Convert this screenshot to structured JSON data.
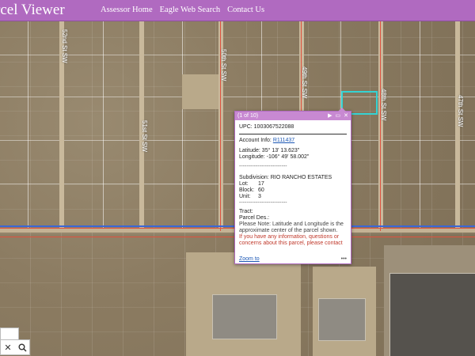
{
  "header": {
    "title": "rcel Viewer",
    "nav": [
      "Assessor Home",
      "Eagle Web Search",
      "Contact Us"
    ]
  },
  "map": {
    "streets": [
      "52nd St SW",
      "51st St SW",
      "50th St SW",
      "49th St SW",
      "48th St SW",
      "47th St SW"
    ]
  },
  "search": {
    "clear_icon": "✕",
    "search_icon": "search-icon"
  },
  "popup": {
    "count": "(1 of 10)",
    "upc": "UPC: 1003067522088",
    "account_label": "Account Info:",
    "account_value": "R111437",
    "latitude": "Latitude: 35° 13' 13.623\"",
    "longitude": "Longitude: -106° 49' 58.002\"",
    "dashes1": "--------------------------",
    "subdivision": "Subdivision: RIO RANCHO ESTATES",
    "lot_label": "Lot:",
    "lot_value": "17",
    "block_label": "Block:",
    "block_value": "60",
    "unit_label": "Unit:",
    "unit_value": "3",
    "dashes2": "--------------------------",
    "tract": "Tract:",
    "parcel_des": "Parcel Des.:",
    "note": "Please Note: Latitude and Longitude is the approximate center of the parcel shown.",
    "contact": "If you have any information, questions or concerns about this parcel, please contact",
    "zoom_to": "Zoom to",
    "more": "•••"
  },
  "colors": {
    "header": "#b06ac0",
    "popup_header": "#c889d2",
    "selection": "#35d3d3"
  }
}
